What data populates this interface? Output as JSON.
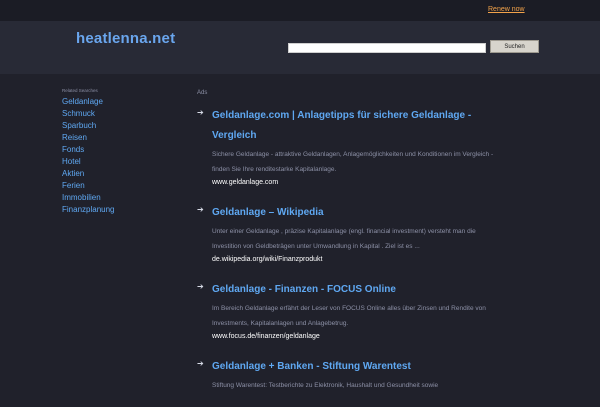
{
  "topbar": {
    "renew_label": "Renew now"
  },
  "header": {
    "logo": "heatlenna.net",
    "search": {
      "value": "",
      "placeholder": "",
      "button_label": "Suchen"
    }
  },
  "sidebar": {
    "title": "Related Searches",
    "items": [
      {
        "label": "Geldanlage"
      },
      {
        "label": "Schmuck"
      },
      {
        "label": "Sparbuch"
      },
      {
        "label": "Reisen"
      },
      {
        "label": "Fonds"
      },
      {
        "label": "Hotel"
      },
      {
        "label": "Aktien"
      },
      {
        "label": "Ferien"
      },
      {
        "label": "Immobilien"
      },
      {
        "label": "Finanzplanung"
      }
    ]
  },
  "main": {
    "ads_label": "Ads",
    "results": [
      {
        "arrow": "➔",
        "title": "Geldanlage.com | Anlagetipps für sichere Geldanlage - Vergleich",
        "desc": "Sichere Geldanlage - attraktive Geldanlagen, Anlagemöglichkeiten und Konditionen im Vergleich - finden Sie Ihre renditestarke Kapitalanlage.",
        "url": "www.geldanlage.com"
      },
      {
        "arrow": "➔",
        "title": "Geldanlage – Wikipedia",
        "desc": "Unter einer Geldanlage , präzise Kapitalanlage (engl. financial investment) versteht man die Investition von Geldbeträgen unter Umwandlung in Kapital . Ziel ist es ...",
        "url": "de.wikipedia.org/wiki/Finanzprodukt"
      },
      {
        "arrow": "➔",
        "title": "Geldanlage - Finanzen - FOCUS Online",
        "desc": "Im Bereich Geldanlage erfährt der Leser von FOCUS Online alles über Zinsen und Rendite von Investments, Kapitalanlagen und Anlagebetrug.",
        "url": "www.focus.de/finanzen/geldanlage"
      },
      {
        "arrow": "➔",
        "title": "Geldanlage + Banken - Stiftung Warentest",
        "desc": "Stiftung Warentest: Testberichte zu Elektronik, Haushalt und Gesundheit sowie",
        "url": ""
      }
    ]
  }
}
